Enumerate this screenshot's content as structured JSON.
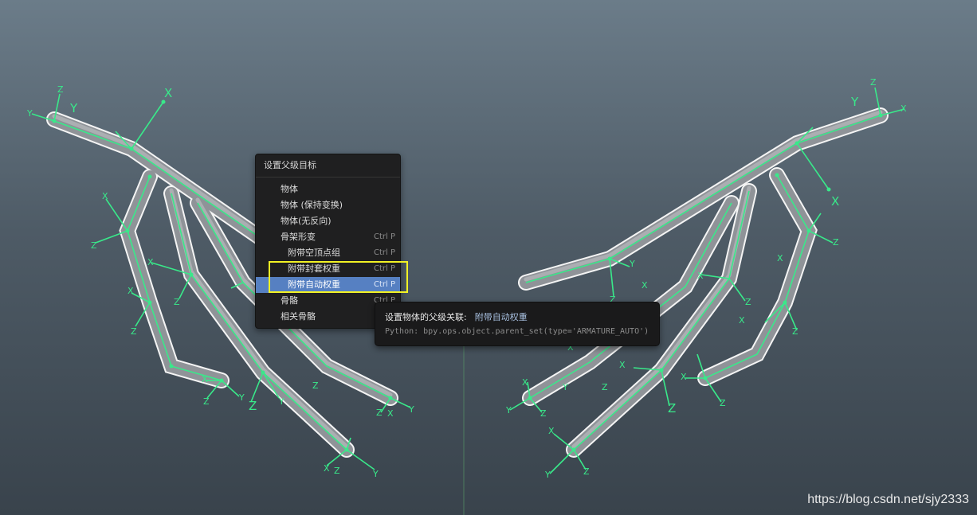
{
  "menu": {
    "title": "设置父级目标",
    "items": [
      {
        "label": "物体",
        "shortcut": ""
      },
      {
        "label": "物体 (保持变换)",
        "shortcut": ""
      },
      {
        "label": "物体(无反向)",
        "shortcut": ""
      },
      {
        "label": "骨架形变",
        "shortcut": "Ctrl P"
      },
      {
        "label": "附带空顶点组",
        "shortcut": "Ctrl P"
      },
      {
        "label": "附带封套权重",
        "shortcut": "Ctrl P"
      },
      {
        "label": "附带自动权重",
        "shortcut": "Ctrl P"
      },
      {
        "label": "骨骼",
        "shortcut": "Ctrl P"
      },
      {
        "label": "相关骨骼",
        "shortcut": ""
      }
    ],
    "active_item": "附带自动权重"
  },
  "tooltip": {
    "label": "设置物体的父级关联:",
    "value": "附带自动权重",
    "python": "Python: bpy.ops.object.parent_set(type='ARMATURE_AUTO')"
  },
  "watermark": "https://blog.csdn.net/sjy2333",
  "colors": {
    "bone_axis": "#39e98a",
    "mesh": "#8f9398",
    "menu_active": "#5680c2",
    "highlight_box": "#f2f224"
  }
}
